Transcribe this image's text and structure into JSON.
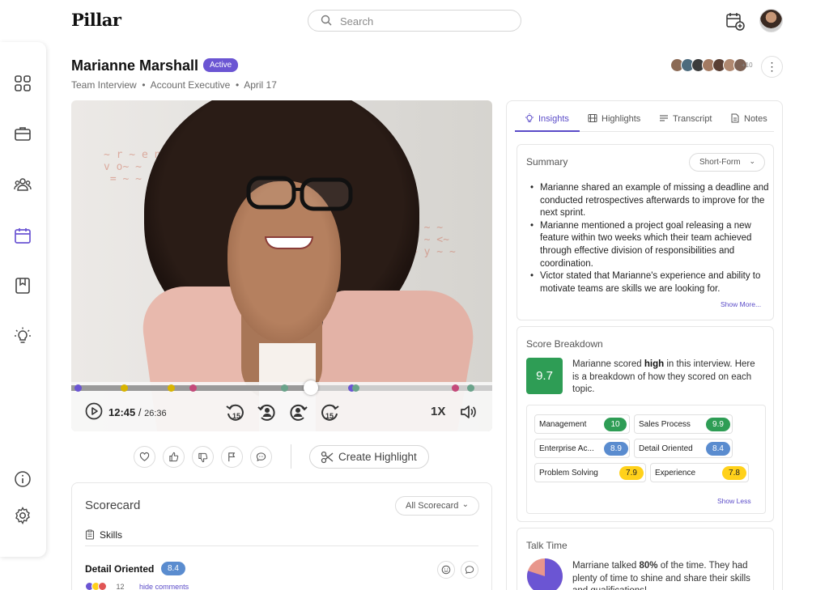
{
  "app": {
    "logo": "Pillar"
  },
  "search": {
    "placeholder": "Search"
  },
  "candidate": {
    "name": "Marianne Marshall",
    "status": "Active",
    "interview_type": "Team Interview",
    "role": "Account Executive",
    "date": "April 17",
    "participants_more": "+10"
  },
  "player": {
    "current_time": "12:45",
    "separator": "/",
    "duration": "26:36",
    "progress": 0.57,
    "speed": "1X",
    "skip_seconds": "15"
  },
  "actions": {
    "create_highlight": "Create Highlight"
  },
  "scorecard": {
    "title": "Scorecard",
    "filter": "All Scorecard",
    "section": "Skills",
    "item": "Detail Oriented",
    "item_score": "8.4",
    "reaction_count": "12",
    "hide_comments": "hide comments"
  },
  "tabs": [
    {
      "label": "Insights",
      "icon": "lightbulb-icon",
      "active": true
    },
    {
      "label": "Highlights",
      "icon": "film-icon"
    },
    {
      "label": "Transcript",
      "icon": "lines-icon"
    },
    {
      "label": "Notes",
      "icon": "note-icon"
    }
  ],
  "summary": {
    "title": "Summary",
    "format": "Short-Form",
    "bullets": [
      "Marianne shared an example of missing a deadline and conducted retrospectives afterwards to improve for the next sprint.",
      "Marianne mentioned a project goal releasing a new feature within two weeks which their team achieved through effective division of responsibilities and coordination.",
      "Victor stated that Marianne's experience and ability to motivate teams are skills we are looking for."
    ],
    "show_more": "Show More..."
  },
  "score_breakdown": {
    "title": "Score Breakdown",
    "overall": "9.7",
    "text_pre": "Marianne scored ",
    "text_bold": "high",
    "text_post": " in this interview. Here is a breakdown of how they scored on each topic.",
    "topics": [
      {
        "name": "Management",
        "score": "10",
        "color": "#2e9d55"
      },
      {
        "name": "Sales Process",
        "score": "9.9",
        "color": "#2e9d55"
      },
      {
        "name": "Enterprise Ac...",
        "score": "8.9",
        "color": "#5a8ccf"
      },
      {
        "name": "Detail Oriented",
        "score": "8.4",
        "color": "#5a8ccf"
      },
      {
        "name": "Problem Solving",
        "score": "7.9",
        "color": "#ffd11a"
      },
      {
        "name": "Experience",
        "score": "7.8",
        "color": "#ffd11a"
      }
    ],
    "show_less": "Show Less"
  },
  "talk_time": {
    "title": "Talk Time",
    "percent": 80,
    "text_pre": "Marriane talked ",
    "text_bold": "80%",
    "text_post": " of the time. They had plenty of time to shine and share their skills and qualifications!"
  },
  "colors": {
    "accent": "#6b55d3",
    "green": "#2e9d55",
    "blue": "#5a8ccf",
    "yellow": "#ffd11a",
    "talk_primary": "#6b55d3",
    "talk_other": "#e8968c"
  }
}
